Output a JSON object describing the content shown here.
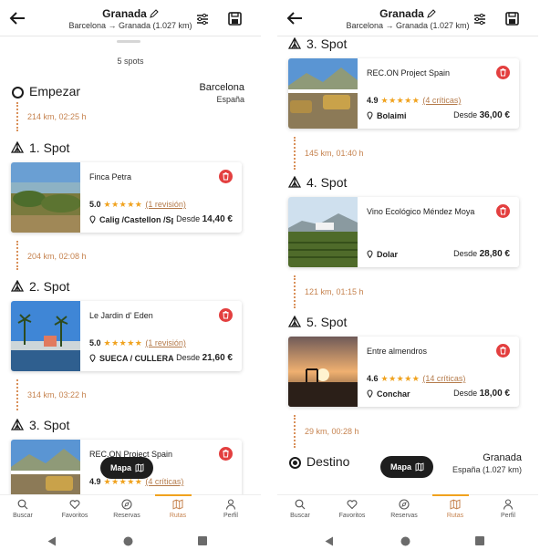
{
  "header": {
    "title": "Granada",
    "subtitle": "Barcelona → Granada (1.027 km)"
  },
  "left": {
    "spots_count": "5 spots",
    "start": {
      "label": "Empezar",
      "city": "Barcelona",
      "country": "España"
    },
    "segments": [
      "214 km, 02:25 h",
      "204 km, 02:08 h",
      "314 km, 03:22 h"
    ],
    "spots": [
      {
        "label": "1. Spot",
        "name": "Finca Petra",
        "score": "5.0",
        "stars": "★★★★★",
        "reviews": "(1 revisión)",
        "location": "Calig /Castellon /Spain",
        "price_prefix": "Desde ",
        "price": "14,40 €"
      },
      {
        "label": "2. Spot",
        "name": "Le Jardin d' Eden",
        "score": "5.0",
        "stars": "★★★★★",
        "reviews": "(1 revisión)",
        "location": "SUECA / CULLERA",
        "price_prefix": "Desde ",
        "price": "21,60 €"
      },
      {
        "label": "3. Spot",
        "name": "REC.ON Project Spain",
        "score": "4.9",
        "stars": "★★★★★",
        "reviews": "(4 críticas)"
      }
    ],
    "map_button": "Mapa"
  },
  "right": {
    "top_label": "3. Spot",
    "segments": [
      "145 km, 01:40 h",
      "121 km, 01:15 h",
      "29 km, 00:28 h"
    ],
    "spots": [
      {
        "name": "REC.ON Project Spain",
        "score": "4.9",
        "stars": "★★★★★",
        "reviews": "(4 críticas)",
        "location": "Bolaimi",
        "price_prefix": "Desde ",
        "price": "36,00 €"
      },
      {
        "label": "4. Spot",
        "name": "Vino Ecológico Méndez Moya",
        "location": "Dolar",
        "price_prefix": "Desde ",
        "price": "28,80 €"
      },
      {
        "label": "5. Spot",
        "name": "Entre almendros",
        "score": "4.6",
        "stars": "★★★★★",
        "reviews": "(14 críticas)",
        "location": "Conchar",
        "price_prefix": "Desde ",
        "price": "18,00 €"
      }
    ],
    "end": {
      "label": "Destino",
      "city": "Granada",
      "country": "España (1.027 km)"
    },
    "map_button": "Mapa"
  },
  "nav": {
    "items": [
      "Buscar",
      "Favoritos",
      "Reservas",
      "Rutas",
      "Perfil"
    ],
    "active": "Rutas"
  },
  "colors": {
    "accent": "#c6834f",
    "star": "#f0a21e",
    "delete": "#e33f3f",
    "dark": "#1e1e1e"
  }
}
